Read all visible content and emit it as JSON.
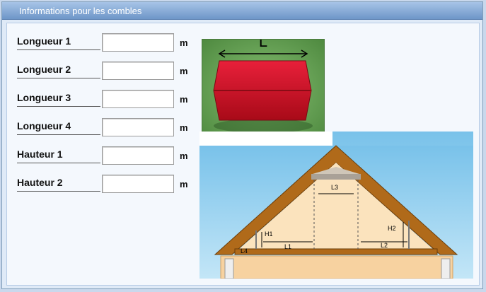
{
  "panel": {
    "title": "Informations pour les combles"
  },
  "fields": [
    {
      "label": "Longueur 1",
      "value": "",
      "unit": "m"
    },
    {
      "label": "Longueur 2",
      "value": "",
      "unit": "m"
    },
    {
      "label": "Longueur 3",
      "value": "",
      "unit": "m"
    },
    {
      "label": "Longueur 4",
      "value": "",
      "unit": "m"
    },
    {
      "label": "Hauteur 1",
      "value": "",
      "unit": "m"
    },
    {
      "label": "Hauteur 2",
      "value": "",
      "unit": "m"
    }
  ],
  "illustrations": {
    "length_diagram": {
      "label": "L"
    },
    "attic_diagram": {
      "labels": {
        "l1": "L1",
        "l2": "L2",
        "l3": "L3",
        "l4": "L4",
        "h1": "H1",
        "h2": "H2"
      }
    }
  },
  "colors": {
    "roof_red": "#d01020",
    "grass": "#6aa35a",
    "timber": "#b06a1a"
  }
}
